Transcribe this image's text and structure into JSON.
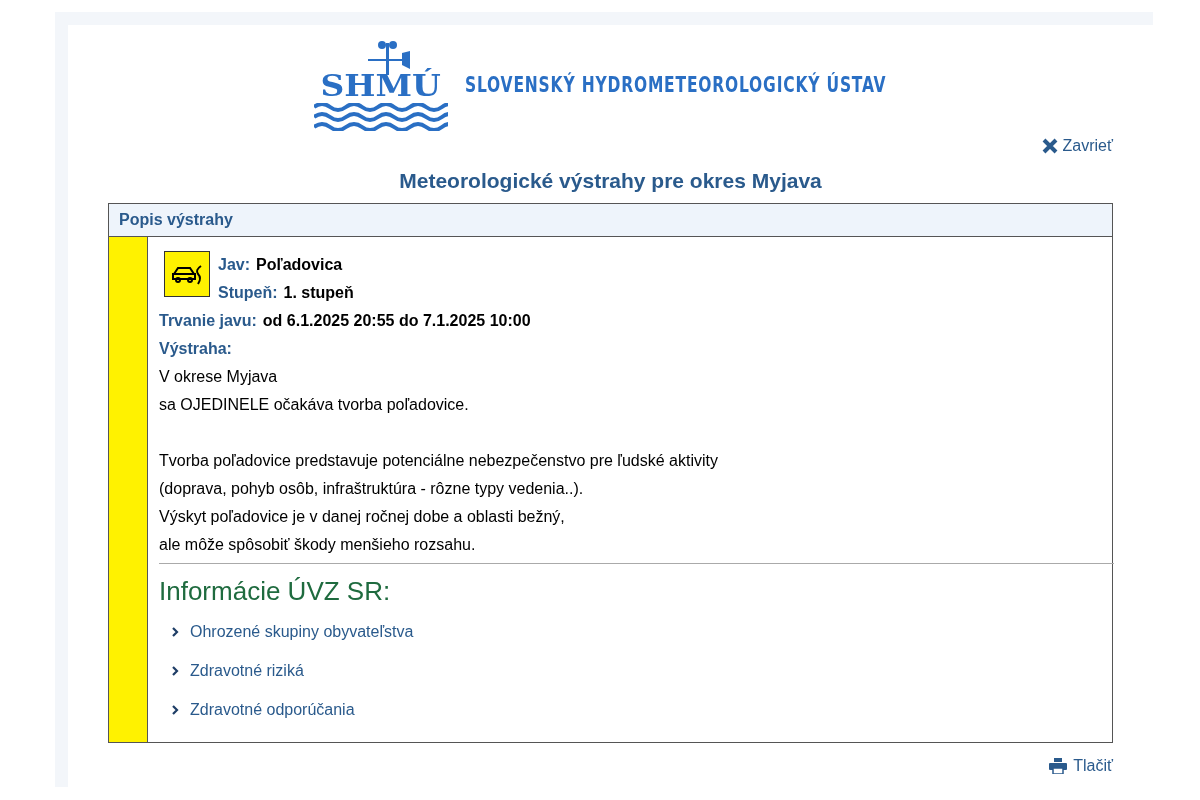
{
  "header": {
    "logo_text": "SHMÚ",
    "institute": "SLOVENSKÝ HYDROMETEOROLOGICKÝ ÚSTAV"
  },
  "close_link": "Zavrieť",
  "page_title": "Meteorologické výstrahy pre okres Myjava",
  "panel": {
    "heading": "Popis výstrahy",
    "warning": {
      "color": "#fff200",
      "fields": [
        {
          "label": "Jav:",
          "value": "Poľadovica"
        },
        {
          "label": "Stupeň:",
          "value": "1. stupeň"
        },
        {
          "label": "Trvanie javu:",
          "value": "od 6.1.2025 20:55 do 7.1.2025 10:00"
        }
      ],
      "text_label": "Výstraha:",
      "paragraphs": [
        [
          "V okrese Myjava",
          "sa OJEDINELE očakáva tvorba poľadovice."
        ],
        [
          "Tvorba poľadovice predstavuje potenciálne nebezpečenstvo pre ľudské aktivity",
          "(doprava, pohyb osôb, infraštruktúra - rôzne typy vedenia..).",
          "Výskyt poľadovice je v danej ročnej dobe a oblasti bežný,",
          "ale môže spôsobiť škody menšieho rozsahu."
        ]
      ]
    },
    "info_heading": "Informácie ÚVZ SR:",
    "info_links": [
      {
        "label": "Ohrozené skupiny obyvateľstva",
        "expanded": false
      },
      {
        "label": "Zdravotné riziká",
        "expanded": false
      },
      {
        "label": "Zdravotné odporúčania",
        "expanded": false
      }
    ]
  },
  "print_link": "Tlačiť"
}
